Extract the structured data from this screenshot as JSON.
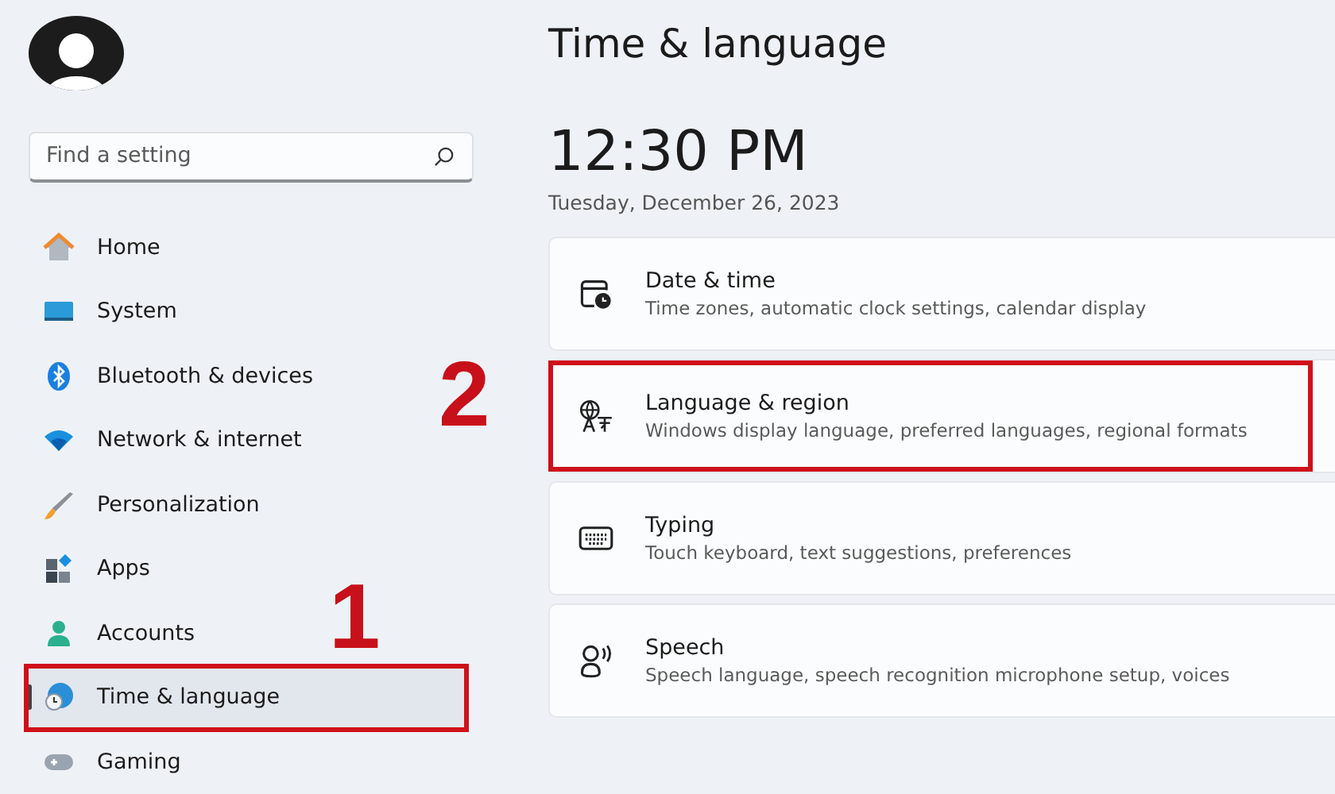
{
  "search": {
    "placeholder": "Find a setting"
  },
  "nav": [
    {
      "label": "Home",
      "kind": "home",
      "selected": false,
      "marked": false
    },
    {
      "label": "System",
      "kind": "system",
      "selected": false,
      "marked": false
    },
    {
      "label": "Bluetooth & devices",
      "kind": "bluetooth",
      "selected": false,
      "marked": false
    },
    {
      "label": "Network & internet",
      "kind": "network",
      "selected": false,
      "marked": false
    },
    {
      "label": "Personalization",
      "kind": "brush",
      "selected": false,
      "marked": false
    },
    {
      "label": "Apps",
      "kind": "apps",
      "selected": false,
      "marked": false
    },
    {
      "label": "Accounts",
      "kind": "accounts",
      "selected": false,
      "marked": false
    },
    {
      "label": "Time & language",
      "kind": "time",
      "selected": true,
      "marked": true
    },
    {
      "label": "Gaming",
      "kind": "gaming",
      "selected": false,
      "marked": false
    }
  ],
  "page_title": "Time & language",
  "clock": {
    "time": "12:30 PM",
    "date": "Tuesday, December 26, 2023"
  },
  "cards": [
    {
      "title": "Date & time",
      "subtitle": "Time zones, automatic clock settings, calendar display",
      "kind": "calendar",
      "marked": false
    },
    {
      "title": "Language & region",
      "subtitle": "Windows display language, preferred languages, regional formats",
      "kind": "language",
      "marked": true
    },
    {
      "title": "Typing",
      "subtitle": "Touch keyboard, text suggestions, preferences",
      "kind": "keyboard",
      "marked": false
    },
    {
      "title": "Speech",
      "subtitle": "Speech language, speech recognition microphone setup, voices",
      "kind": "speech",
      "marked": false
    }
  ],
  "callouts": [
    {
      "label": "1"
    },
    {
      "label": "2"
    }
  ]
}
